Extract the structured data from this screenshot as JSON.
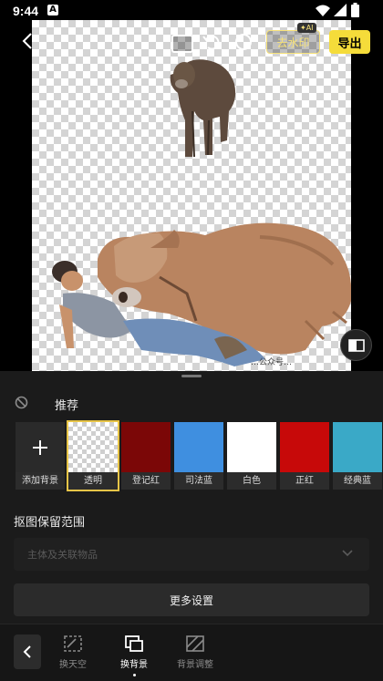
{
  "status_bar": {
    "time": "9:44",
    "notif_letter": "A"
  },
  "top_bar": {
    "remove_watermark_label": "去水印",
    "ai_badge": "✦AI",
    "export_label": "导出"
  },
  "canvas": {
    "watermark_text": "…公众号…"
  },
  "panel": {
    "recommend_label": "推荐",
    "backgrounds": [
      {
        "label": "添加背景",
        "kind": "add"
      },
      {
        "label": "透明",
        "kind": "transparent",
        "selected": true
      },
      {
        "label": "登记红",
        "color": "#7b0707"
      },
      {
        "label": "司法蓝",
        "color": "#3f8fe0"
      },
      {
        "label": "白色",
        "color": "#ffffff"
      },
      {
        "label": "正红",
        "color": "#c70909"
      },
      {
        "label": "经典蓝",
        "color": "#3aa9c7"
      }
    ],
    "keep_range_title": "抠图保留范围",
    "keep_range_value": "主体及关联物品",
    "more_settings_label": "更多设置"
  },
  "toolbar": {
    "items": [
      {
        "label": "换天空"
      },
      {
        "label": "换背景",
        "active": true
      },
      {
        "label": "背景调整"
      }
    ]
  },
  "colors": {
    "accent": "#f5dc3a",
    "panel_bg": "#1b1b1b",
    "selected_outline": "#e8c547"
  }
}
